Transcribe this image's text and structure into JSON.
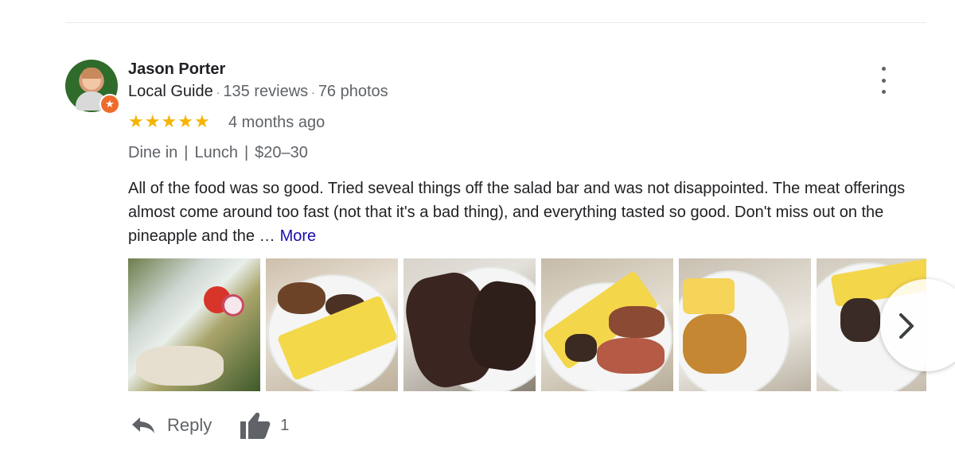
{
  "reviewer": {
    "name": "Jason Porter",
    "guide_label": "Local Guide",
    "reviews": "135 reviews",
    "photos": "76 photos"
  },
  "rating": {
    "stars": 5,
    "max": 5,
    "time_ago": "4 months ago"
  },
  "tags": [
    "Dine in",
    "Lunch",
    "$20–30"
  ],
  "review_text": "All of the food was so good. Tried seveal things off the salad bar and was not disappointed. The meat offerings almost come around too fast (not that it's a bad thing), and everything tasted so good. Don't miss out on the pineapple and the …",
  "more_label": "More",
  "photos": [
    {
      "icon": "salad-photo"
    },
    {
      "icon": "pineapple-mushroom-photo"
    },
    {
      "icon": "steak-photo"
    },
    {
      "icon": "pineapple-meat-photo"
    },
    {
      "icon": "pineapple-pastry-photo"
    },
    {
      "icon": "pineapple-meat-photo"
    }
  ],
  "actions": {
    "reply_label": "Reply",
    "like_count": "1"
  },
  "colors": {
    "star": "#f4b400",
    "link": "#1a0dab",
    "muted": "#5f6368",
    "badge": "#ee6c2b"
  }
}
